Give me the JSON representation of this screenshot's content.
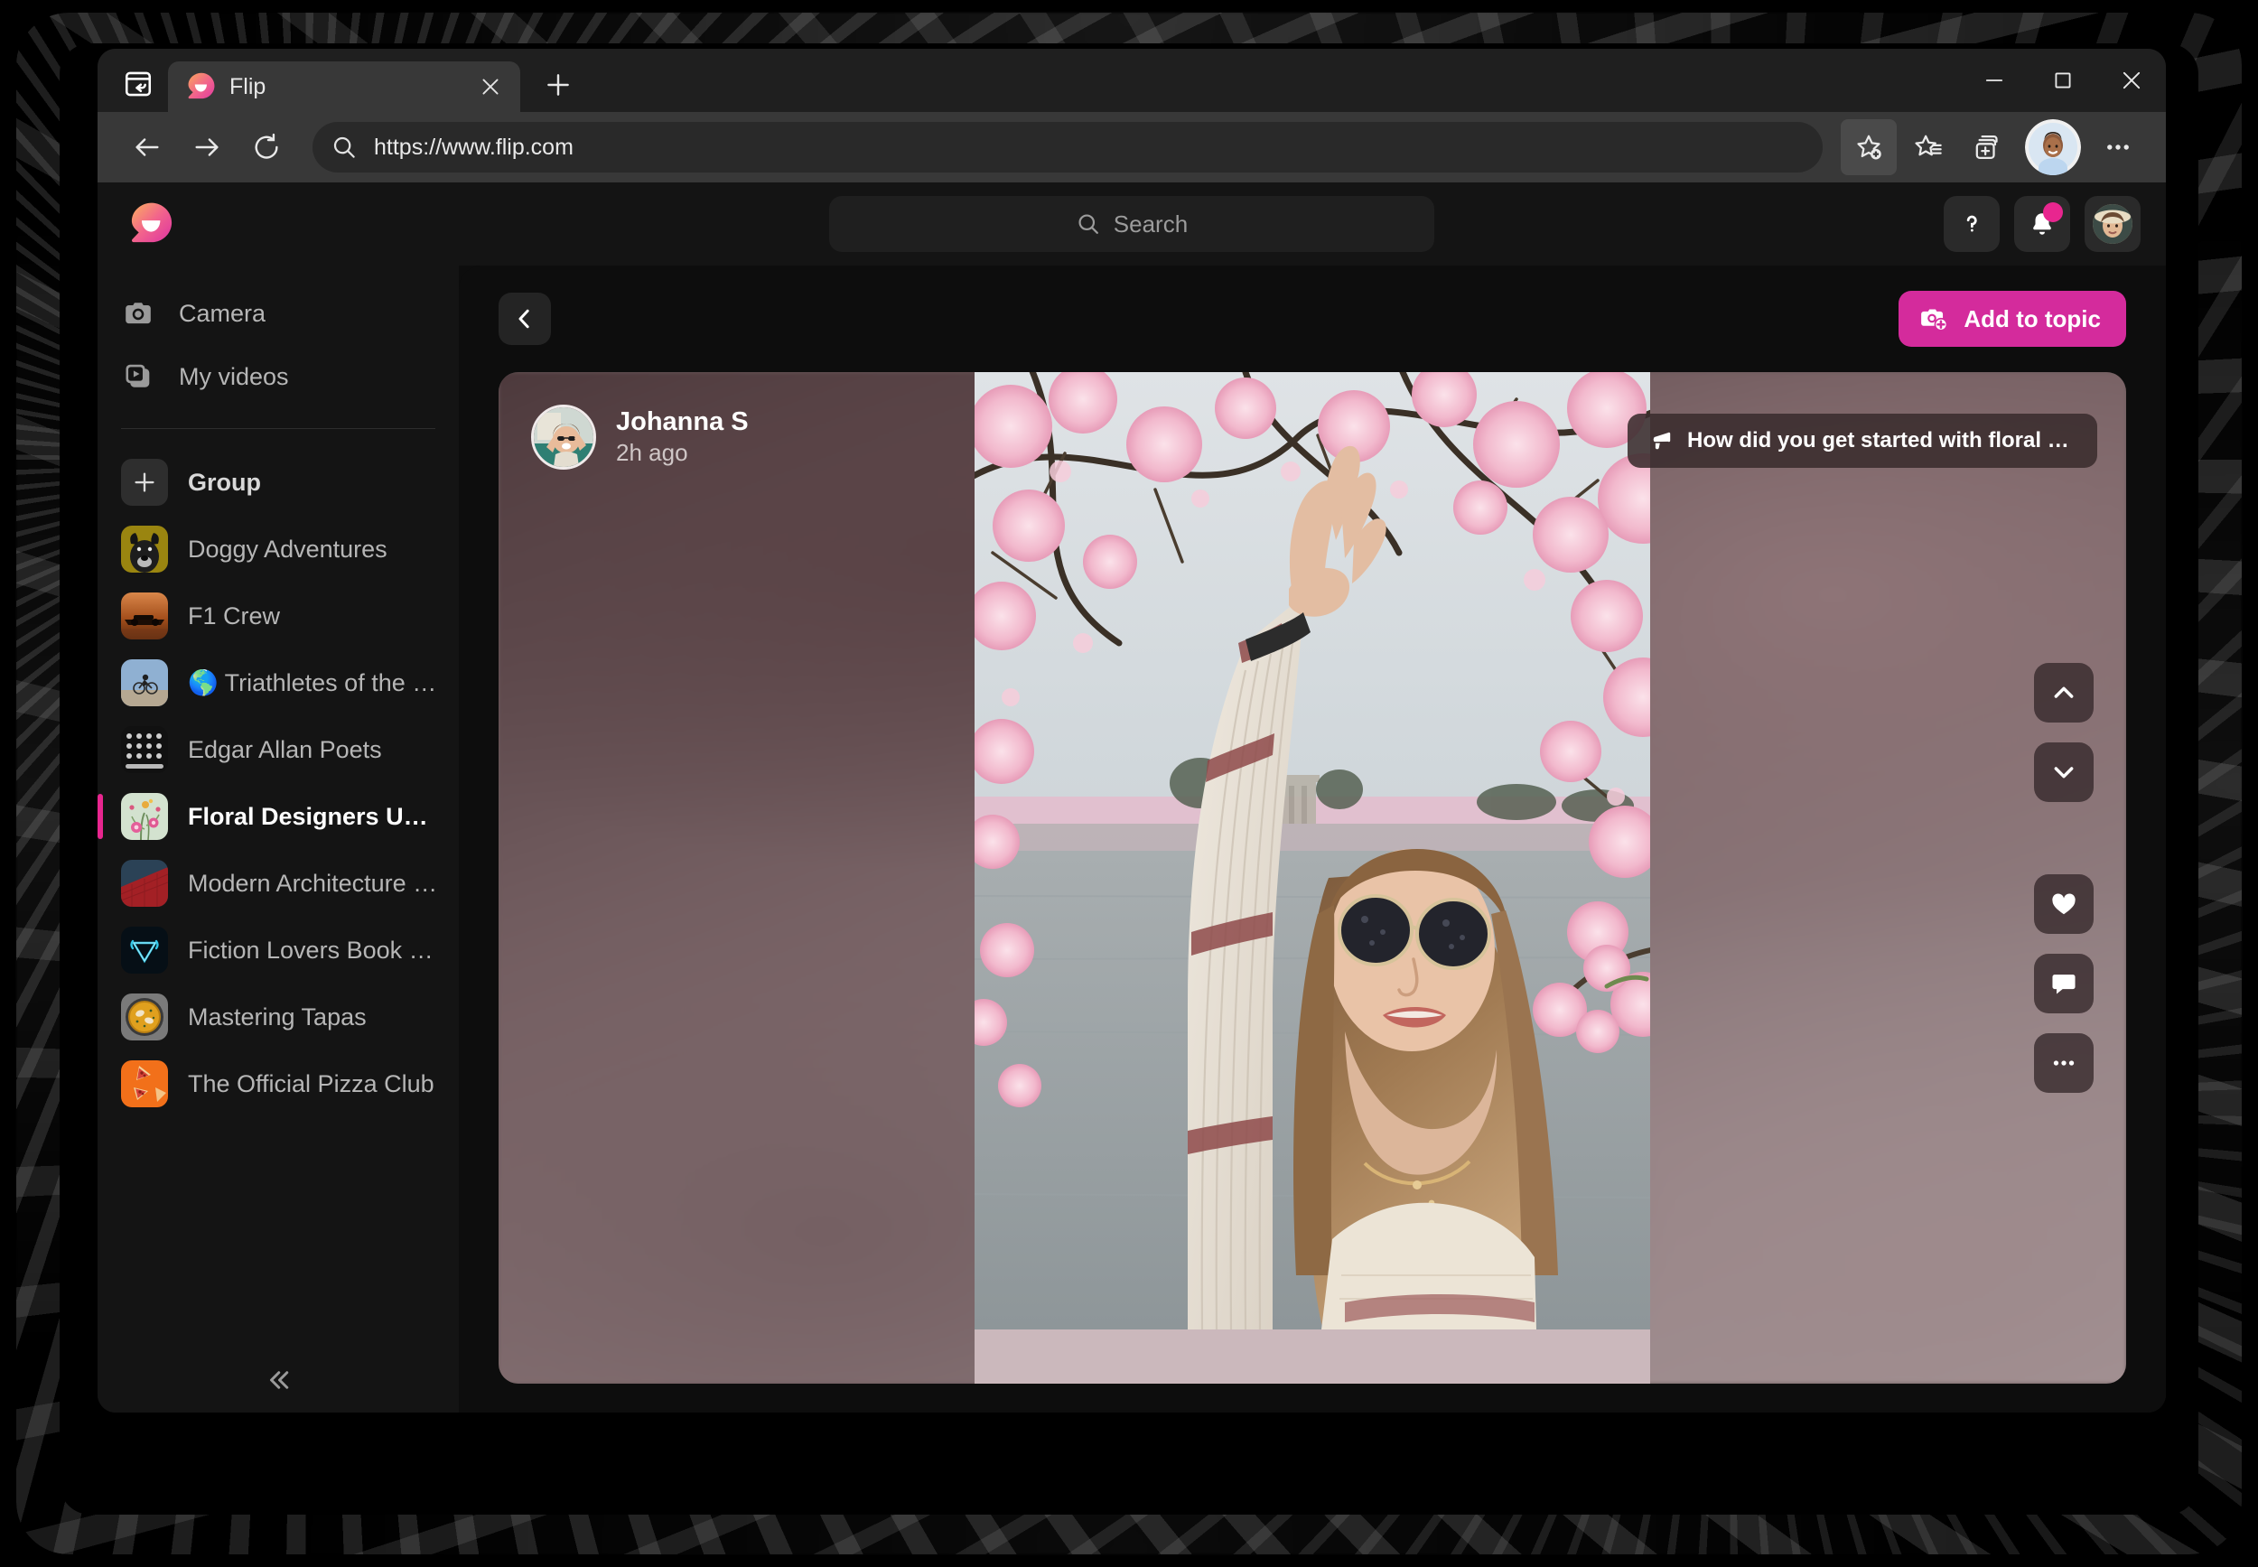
{
  "browser": {
    "tab": {
      "title": "Flip",
      "favicon": "flip-logo-icon"
    },
    "new_tab_label": "+",
    "url": "https://www.flip.com",
    "toolbar_icons": [
      "back-arrow-icon",
      "forward-arrow-icon",
      "reload-icon",
      "search-icon",
      "add-favorite-icon",
      "favorites-icon",
      "collections-icon",
      "profile-avatar-icon",
      "settings-more-icon"
    ],
    "window_controls": [
      "minimize-icon",
      "maximize-icon",
      "close-icon"
    ],
    "tab_tools_label": "tab-actions-icon"
  },
  "app": {
    "logo": "flip-logo-icon",
    "search": {
      "placeholder": "Search",
      "value": ""
    },
    "header_actions": [
      {
        "name": "help-button",
        "icon": "question-mark-icon",
        "label": "?"
      },
      {
        "name": "notifications-button",
        "icon": "bell-icon",
        "badge": true
      },
      {
        "name": "account-avatar",
        "icon": "avatar-icon"
      }
    ],
    "accent_color": "#e8268f",
    "button_color": "#d42b9c"
  },
  "sidebar": {
    "nav": [
      {
        "label": "Camera",
        "icon": "camera-icon"
      },
      {
        "label": "My videos",
        "icon": "video-library-icon"
      }
    ],
    "add_group": {
      "label": "Group",
      "icon": "plus-icon"
    },
    "groups": [
      {
        "label": "Doggy Adventures",
        "active": false,
        "thumb": "#9a8510"
      },
      {
        "label": "F1 Crew",
        "active": false,
        "thumb": "#b4601f"
      },
      {
        "label": "🌎 Triathletes of the World",
        "active": false,
        "thumb": "#7d9dc4"
      },
      {
        "label": "Edgar Allan Poets",
        "active": false,
        "thumb": "#0e0e0e"
      },
      {
        "label": "Floral Designers Unite",
        "active": true,
        "thumb": "#cfe0cc"
      },
      {
        "label": "Modern Architecture Princ...",
        "active": false,
        "thumb": "#2b4256"
      },
      {
        "label": "Fiction Lovers Book Club",
        "active": false,
        "thumb": "#06141c"
      },
      {
        "label": "Mastering Tapas",
        "active": false,
        "thumb": "#6e6e6e"
      },
      {
        "label": "The Official Pizza Club",
        "active": false,
        "thumb": "#f2701a"
      }
    ],
    "collapse_label": "collapse-sidebar-icon"
  },
  "main": {
    "back_label": "back-chevron-icon",
    "add_to_topic": {
      "label": "Add to topic",
      "icon": "camera-plus-icon"
    },
    "post": {
      "author": "Johanna S",
      "timestamp": "2h ago",
      "avatar": "author-avatar-icon"
    },
    "topic": {
      "icon": "megaphone-icon",
      "text": "How did you get started with floral arrang..."
    },
    "rail": [
      {
        "name": "previous-video-button",
        "icon": "chevron-up-icon"
      },
      {
        "name": "next-video-button",
        "icon": "chevron-down-icon"
      },
      {
        "name": "like-button",
        "icon": "heart-icon"
      },
      {
        "name": "comment-button",
        "icon": "comment-icon"
      },
      {
        "name": "more-options-button",
        "icon": "ellipsis-icon"
      }
    ]
  }
}
